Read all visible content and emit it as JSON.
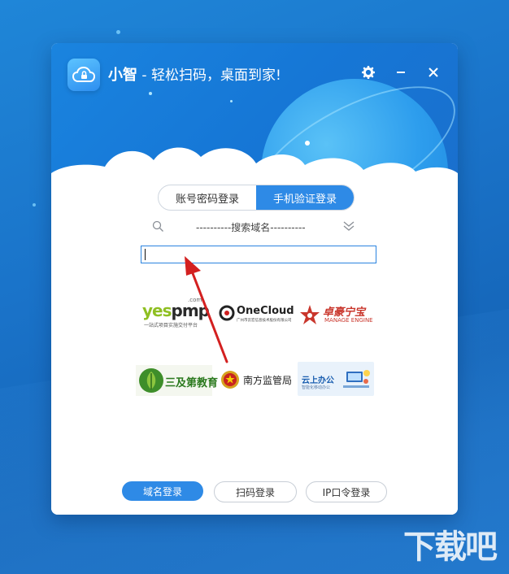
{
  "app": {
    "name": "小智",
    "slogan": " - 轻松扫码，桌面到家!"
  },
  "login_tabs": [
    {
      "label": "账号密码登录",
      "active": false
    },
    {
      "label": "手机验证登录",
      "active": true
    }
  ],
  "search": {
    "label": "----------搜索域名----------",
    "input_value": ""
  },
  "partners": {
    "yespmp": {
      "brand_a": "yes",
      "brand_b": "pmp",
      "com": ".com",
      "tagline": "一站式项目实施交付平台"
    },
    "onecloud": {
      "brand": "OneCloud",
      "sub": "广州市云宏信息技术股份有限公司"
    },
    "manage_engine": {
      "cn": "卓豪宁宝",
      "en": "MANAGE ENGINE"
    },
    "sanji": {
      "text": "三及第教育"
    },
    "nanfang": {
      "text": "南方监管局"
    },
    "yunshang": {
      "text": "云上办公",
      "sub": "智能化移动办公"
    }
  },
  "bottom_buttons": [
    {
      "label": "域名登录",
      "primary": true
    },
    {
      "label": "扫码登录",
      "primary": false
    },
    {
      "label": "IP口令登录",
      "primary": false
    }
  ],
  "watermark": "下载吧",
  "colors": {
    "accent": "#2e8ae6",
    "header": "#1a7bd8",
    "annotation_arrow": "#d32020"
  }
}
